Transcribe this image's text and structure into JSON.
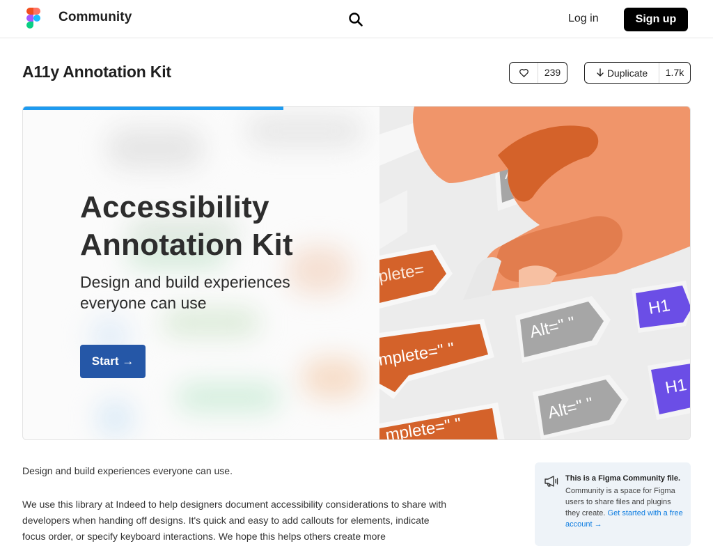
{
  "header": {
    "brand": "Community",
    "login_label": "Log in",
    "signup_label": "Sign up"
  },
  "file": {
    "title": "A11y Annotation Kit",
    "likes": "239",
    "duplicate_label": "Duplicate",
    "duplicates": "1.7k"
  },
  "hero": {
    "progress_fraction": 0.39,
    "title_line1": "Accessibility",
    "title_line2": "Annotation Kit",
    "subtitle_line1": "Design and build experiences",
    "subtitle_line2": "everyone can use",
    "start_label": "Start →",
    "stickers": {
      "complete_text_1": "plete=",
      "complete_text_2": "mplete=\" \"",
      "complete_text_3": "mplete=\" \"",
      "alt_text_1": "Al",
      "alt_text_2": "Alt=\" \"",
      "alt_text_3": "Alt=\" \"",
      "h1_text_1": "H1",
      "h1_text_2": "H1"
    },
    "colors": {
      "start_button": "#2557a7",
      "orange_sticker": "#d4622a",
      "grey_sticker": "#a6a6a6",
      "purple_sticker": "#6b4ee6",
      "hand": "#f0956a"
    }
  },
  "description": {
    "line1": "Design and build experiences everyone can use.",
    "para": "We use this library at Indeed to help designers document accessibility considerations to share with developers when handing off designs. It's quick and easy to add callouts for elements, indicate focus order, or specify keyboard interactions. We hope this helps others create more"
  },
  "info_card": {
    "title": "This is a Figma Community file.",
    "body": "Community is a space for Figma users to share files and plugins they create.",
    "link": "Get started with a free account →"
  }
}
